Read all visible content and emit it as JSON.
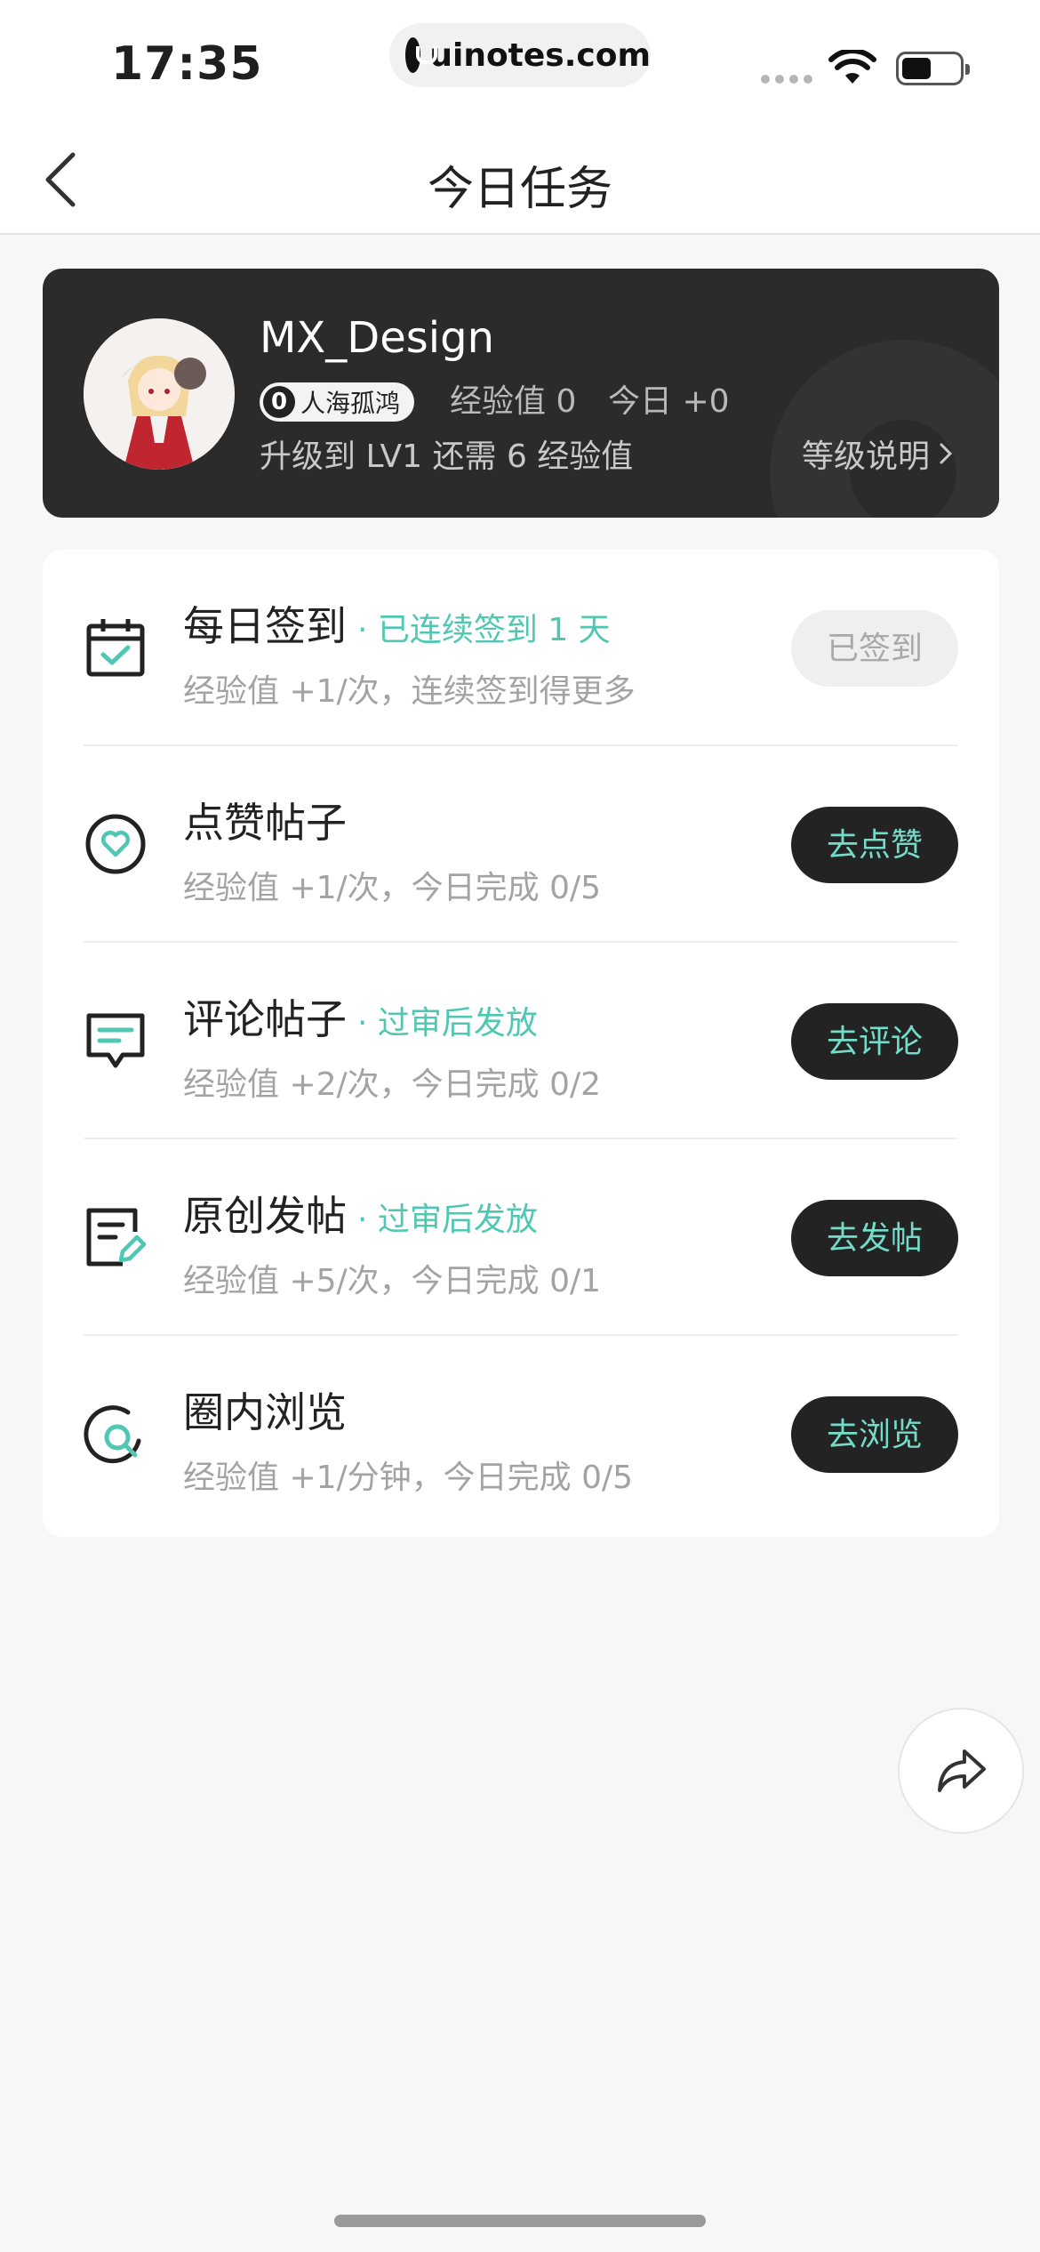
{
  "status_bar": {
    "time": "17:35",
    "url": "uinotes.com"
  },
  "nav": {
    "title": "今日任务"
  },
  "profile": {
    "username": "MX_Design",
    "level_number": "0",
    "level_name": "人海孤鸿",
    "exp_label": "经验值 0",
    "today_label": "今日 +0",
    "upgrade_text": "升级到 LV1 还需 6 经验值",
    "level_link": "等级说明"
  },
  "tasks": [
    {
      "title": "每日签到",
      "subtitle": "· 已连续签到 1 天",
      "desc": "经验值 +1/次，连续签到得更多",
      "button": "已签到",
      "icon": "calendar-check-icon"
    },
    {
      "title": "点赞帖子",
      "subtitle": "",
      "desc": "经验值 +1/次，今日完成 0/5",
      "button": "去点赞",
      "icon": "heart-circle-icon"
    },
    {
      "title": "评论帖子",
      "subtitle": "· 过审后发放",
      "desc": "经验值 +2/次，今日完成 0/2",
      "button": "去评论",
      "icon": "comment-icon"
    },
    {
      "title": "原创发帖",
      "subtitle": "· 过审后发放",
      "desc": "经验值 +5/次，今日完成 0/1",
      "button": "去发帖",
      "icon": "edit-post-icon"
    },
    {
      "title": "圈内浏览",
      "subtitle": "",
      "desc": "经验值 +1/分钟，今日完成 0/5",
      "button": "去浏览",
      "icon": "browse-search-icon"
    }
  ],
  "colors": {
    "accent": "#4fc7b2",
    "button_text": "#73dcc8",
    "dark_card": "#2b2b2b"
  }
}
